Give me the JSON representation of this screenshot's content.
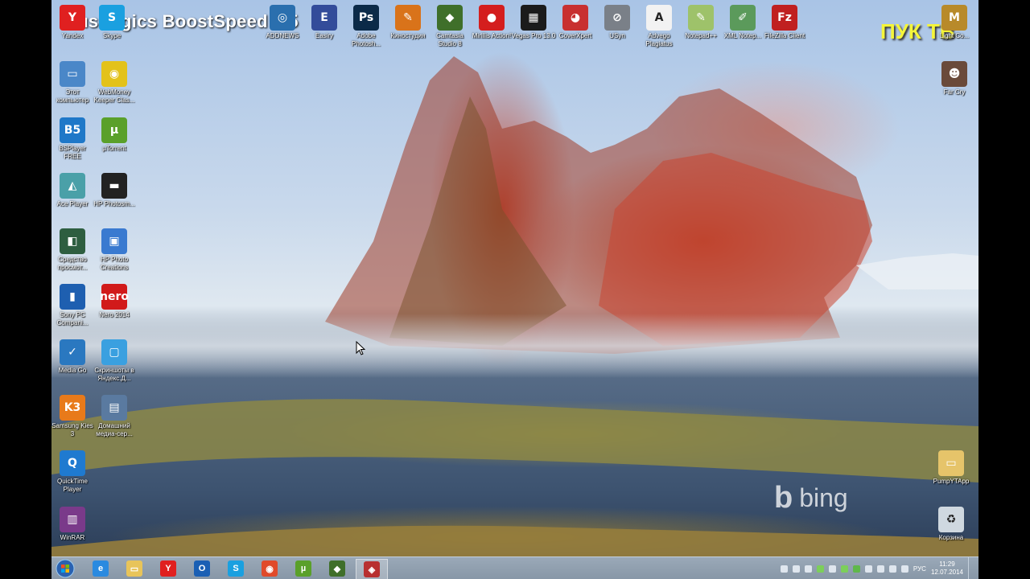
{
  "overlay": {
    "title": "AusLogics BoostSpeed 6.5",
    "watermark": "ПУК ТВ"
  },
  "wallpaper": {
    "brand": "bing"
  },
  "desktop_icons": [
    {
      "label": "Yandex",
      "icon": "yandex-icon",
      "color": "#e02020",
      "glyph": "Y"
    },
    {
      "label": "Skype",
      "icon": "skype-icon",
      "color": "#1aa0e0",
      "glyph": "S"
    },
    {
      "label": "ADDNEWS",
      "icon": "addnews-icon",
      "color": "#2a6fae",
      "glyph": "◎"
    },
    {
      "label": "Easiry",
      "icon": "easiry-icon",
      "color": "#334c9a",
      "glyph": "E"
    },
    {
      "label": "Adobe Photosh...",
      "icon": "photoshop-icon",
      "color": "#0b2a48",
      "glyph": "Ps"
    },
    {
      "label": "Киностудия",
      "icon": "movie-studio-icon",
      "color": "#d9731a",
      "glyph": "✎"
    },
    {
      "label": "Camtasia Studio 8",
      "icon": "camtasia-icon",
      "color": "#3f6f2a",
      "glyph": "◆"
    },
    {
      "label": "Mirillis Action!",
      "icon": "action-icon",
      "color": "#d41e1e",
      "glyph": "●"
    },
    {
      "label": "Vegas Pro 13.0",
      "icon": "vegas-icon",
      "color": "#1b1b1b",
      "glyph": "▦"
    },
    {
      "label": "CoverXpert",
      "icon": "coverxpert-icon",
      "color": "#c83030",
      "glyph": "◕"
    },
    {
      "label": "USyn",
      "icon": "usyn-icon",
      "color": "#7a8088",
      "glyph": "⊘"
    },
    {
      "label": "Advego Plagiatus",
      "icon": "advego-icon",
      "color": "#f2f2f2",
      "glyph": "A"
    },
    {
      "label": "Notepad++",
      "icon": "notepadpp-icon",
      "color": "#9ec26a",
      "glyph": "✎"
    },
    {
      "label": "XML Notep...",
      "icon": "xml-notepad-icon",
      "color": "#5b9a5b",
      "glyph": "✐"
    },
    {
      "label": "FileZilla Client",
      "icon": "filezilla-icon",
      "color": "#c02020",
      "glyph": "Fz"
    },
    {
      "label": "Light Co...",
      "icon": "metro-icon",
      "color": "#b88a2a",
      "glyph": "M"
    },
    {
      "label": "Этот компьютер",
      "icon": "computer-icon",
      "color": "#4a87c8",
      "glyph": "▭"
    },
    {
      "label": "WebMoney Keeper Clas...",
      "icon": "webmoney-icon",
      "color": "#e3c21a",
      "glyph": "◉"
    },
    {
      "label": "Far Cry",
      "icon": "farcry-icon",
      "color": "#6a4a3a",
      "glyph": "☻"
    },
    {
      "label": "BSPlayer FREE",
      "icon": "bsplayer-icon",
      "color": "#1f78c8",
      "glyph": "B5"
    },
    {
      "label": "µTorrent",
      "icon": "utorrent-icon",
      "color": "#5aa02a",
      "glyph": "µ"
    },
    {
      "label": "Ace Player",
      "icon": "aceplayer-icon",
      "color": "#4aa0a8",
      "glyph": "◭"
    },
    {
      "label": "HP Photosm...",
      "icon": "hp-photosmart-icon",
      "color": "#222222",
      "glyph": "▬"
    },
    {
      "label": "Средство просмот...",
      "icon": "viewer-icon",
      "color": "#2e5e40",
      "glyph": "◧"
    },
    {
      "label": "HP Photo Creations",
      "icon": "hp-photo-creations-icon",
      "color": "#3a7ad0",
      "glyph": "▣"
    },
    {
      "label": "Sony PC Compani...",
      "icon": "sony-icon",
      "color": "#1e5fb0",
      "glyph": "▮"
    },
    {
      "label": "Nero 2014",
      "icon": "nero-icon",
      "color": "#d11a1a",
      "glyph": "nero"
    },
    {
      "label": "Media Go",
      "icon": "mediago-icon",
      "color": "#2a78c0",
      "glyph": "✓"
    },
    {
      "label": "Скриншоты в Яндекс.Д...",
      "icon": "yandex-disk-icon",
      "color": "#3aa0e0",
      "glyph": "▢"
    },
    {
      "label": "Samsung Kies 3",
      "icon": "kies-icon",
      "color": "#e87a1a",
      "glyph": "K3"
    },
    {
      "label": "Домашний медиа-сер...",
      "icon": "media-server-icon",
      "color": "#5a7aa0",
      "glyph": "▤"
    },
    {
      "label": "PumpYTApp",
      "icon": "folder-icon",
      "color": "#e6c46a",
      "glyph": "▭"
    },
    {
      "label": "QuickTime Player",
      "icon": "quicktime-icon",
      "color": "#1f7ad0",
      "glyph": "Q"
    },
    {
      "label": "WinRAR",
      "icon": "winrar-icon",
      "color": "#7a3a8a",
      "glyph": "▥"
    },
    {
      "label": "Корзина",
      "icon": "recycle-bin-icon",
      "color": "#cfd8e0",
      "glyph": "♻"
    }
  ],
  "taskbar": {
    "items": [
      {
        "icon": "internet-explorer-icon",
        "color": "#2a8ae0",
        "glyph": "e"
      },
      {
        "icon": "file-explorer-icon",
        "color": "#e8c45a",
        "glyph": "▭"
      },
      {
        "icon": "yandex-browser-icon",
        "color": "#e02020",
        "glyph": "Y"
      },
      {
        "icon": "outlook-icon",
        "color": "#1a5fb4",
        "glyph": "O"
      },
      {
        "icon": "skype-icon",
        "color": "#1aa0e0",
        "glyph": "S"
      },
      {
        "icon": "chrome-icon",
        "color": "#e04a2a",
        "glyph": "◉"
      },
      {
        "icon": "utorrent-icon",
        "color": "#5aa02a",
        "glyph": "µ"
      },
      {
        "icon": "camtasia-icon",
        "color": "#3f6f2a",
        "glyph": "◆"
      },
      {
        "icon": "camtasia-recorder-icon",
        "color": "#b83030",
        "glyph": "◈"
      }
    ],
    "language": "РУС",
    "time": "11:29",
    "date": "12.07.2014"
  }
}
